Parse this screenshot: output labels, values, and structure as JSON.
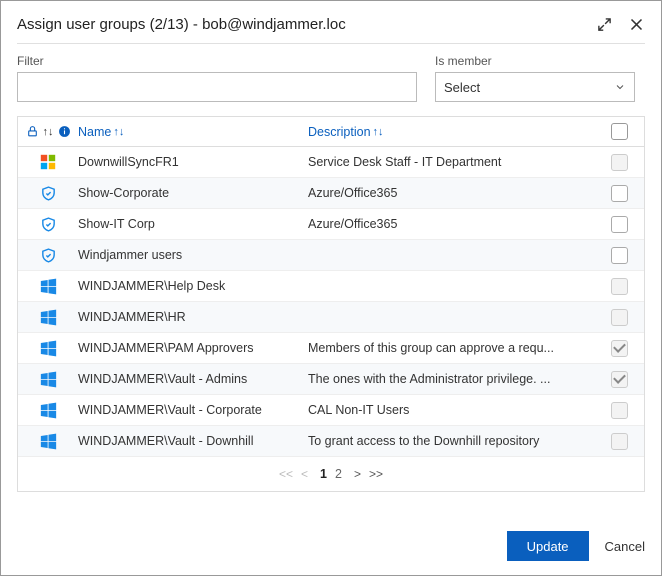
{
  "header": {
    "title": "Assign user groups (2/13) - bob@windjammer.loc"
  },
  "filters": {
    "filter_label": "Filter",
    "filter_value": "",
    "member_label": "Is member",
    "member_value": "Select"
  },
  "columns": {
    "name": "Name",
    "description": "Description"
  },
  "rows": [
    {
      "icon": "ms",
      "name": "DownwillSyncFR1",
      "desc": "Service Desk Staff - IT Department",
      "checked": false,
      "enabled": false
    },
    {
      "icon": "shield",
      "name": "Show-Corporate",
      "desc": "Azure/Office365",
      "checked": false,
      "enabled": true
    },
    {
      "icon": "shield",
      "name": "Show-IT Corp",
      "desc": "Azure/Office365",
      "checked": false,
      "enabled": true
    },
    {
      "icon": "shield",
      "name": "Windjammer users",
      "desc": "",
      "checked": false,
      "enabled": true
    },
    {
      "icon": "win",
      "name": "WINDJAMMER\\Help Desk",
      "desc": "",
      "checked": false,
      "enabled": false
    },
    {
      "icon": "win",
      "name": "WINDJAMMER\\HR",
      "desc": "",
      "checked": false,
      "enabled": false
    },
    {
      "icon": "win",
      "name": "WINDJAMMER\\PAM Approvers",
      "desc": "Members of this group can approve a requ...",
      "checked": true,
      "enabled": false
    },
    {
      "icon": "win",
      "name": "WINDJAMMER\\Vault - Admins",
      "desc": "The ones with the Administrator privilege. ...",
      "checked": true,
      "enabled": false
    },
    {
      "icon": "win",
      "name": "WINDJAMMER\\Vault - Corporate",
      "desc": "CAL Non-IT Users",
      "checked": false,
      "enabled": false
    },
    {
      "icon": "win",
      "name": "WINDJAMMER\\Vault - Downhill",
      "desc": "To grant access to the Downhill repository",
      "checked": false,
      "enabled": false
    }
  ],
  "pager": {
    "pages": [
      "1",
      "2"
    ],
    "active": "1"
  },
  "footer": {
    "update": "Update",
    "cancel": "Cancel"
  }
}
